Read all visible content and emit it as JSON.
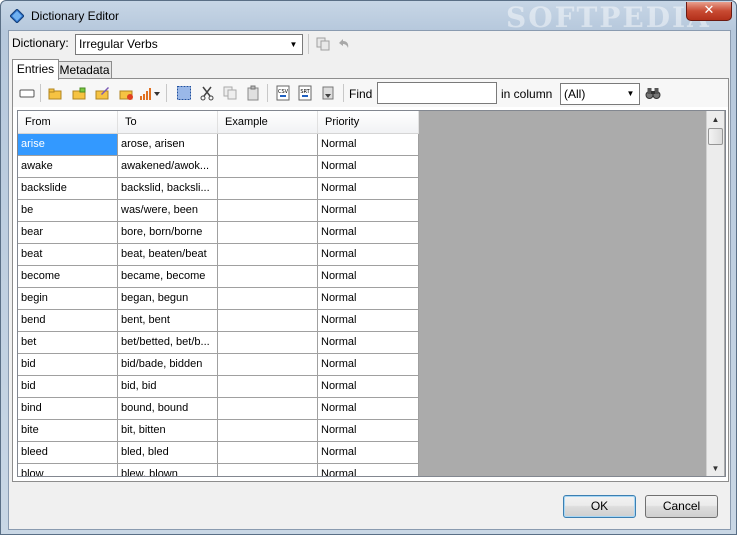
{
  "window": {
    "title": "Dictionary Editor",
    "watermark": "SOFTPEDIA",
    "close_glyph": "✕"
  },
  "dictionary": {
    "label": "Dictionary:",
    "selected": "Irregular Verbs"
  },
  "tabs": [
    {
      "label": "Entries",
      "active": true
    },
    {
      "label": "Metadata",
      "active": false
    }
  ],
  "toolbar": {
    "icons": [
      "new-entry-icon",
      "insert-entry-icon",
      "insert-after-icon",
      "edit-entry-icon",
      "delete-entry-icon",
      "frequency-icon",
      "select-all-icon",
      "cut-icon",
      "copy-icon",
      "paste-icon",
      "import-csv-icon",
      "import-srt-icon",
      "export-icon"
    ],
    "find_label": "Find",
    "find_value": "",
    "in_column_label": "in column",
    "column_selected": "(All)"
  },
  "grid": {
    "columns": [
      "From",
      "To",
      "Example",
      "Priority"
    ],
    "rows": [
      [
        "arise",
        "arose, arisen",
        "",
        "Normal"
      ],
      [
        "awake",
        "awakened/awok...",
        "",
        "Normal"
      ],
      [
        "backslide",
        "backslid, backsli...",
        "",
        "Normal"
      ],
      [
        "be",
        "was/were, been",
        "",
        "Normal"
      ],
      [
        "bear",
        "bore, born/borne",
        "",
        "Normal"
      ],
      [
        "beat",
        "beat, beaten/beat",
        "",
        "Normal"
      ],
      [
        "become",
        "became, become",
        "",
        "Normal"
      ],
      [
        "begin",
        "began, begun",
        "",
        "Normal"
      ],
      [
        "bend",
        "bent, bent",
        "",
        "Normal"
      ],
      [
        "bet",
        "bet/betted, bet/b...",
        "",
        "Normal"
      ],
      [
        "bid",
        "bid/bade, bidden",
        "",
        "Normal"
      ],
      [
        "bid",
        "bid, bid",
        "",
        "Normal"
      ],
      [
        "bind",
        "bound, bound",
        "",
        "Normal"
      ],
      [
        "bite",
        "bit, bitten",
        "",
        "Normal"
      ],
      [
        "bleed",
        "bled, bled",
        "",
        "Normal"
      ],
      [
        "blow",
        "blew, blown",
        "",
        "Normal"
      ]
    ]
  },
  "buttons": {
    "ok": "OK",
    "cancel": "Cancel"
  },
  "colors": {
    "selection": "#3399ff",
    "grid_empty": "#ababab"
  }
}
